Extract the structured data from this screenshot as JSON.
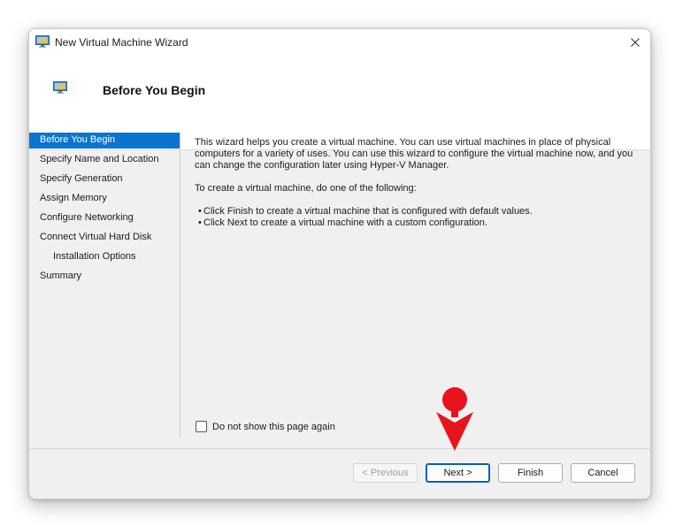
{
  "window": {
    "title": "New Virtual Machine Wizard",
    "header_title": "Before You Begin"
  },
  "nav": {
    "items": [
      {
        "label": "Before You Begin",
        "active": true
      },
      {
        "label": "Specify Name and Location"
      },
      {
        "label": "Specify Generation"
      },
      {
        "label": "Assign Memory"
      },
      {
        "label": "Configure Networking"
      },
      {
        "label": "Connect Virtual Hard Disk"
      },
      {
        "label": "Installation Options",
        "sub": true
      },
      {
        "label": "Summary"
      }
    ]
  },
  "content": {
    "intro": "This wizard helps you create a virtual machine. You can use virtual machines in place of physical computers for a variety of uses. You can use this wizard to configure the virtual machine now, and you can change the configuration later using Hyper-V Manager.",
    "instruction": "To create a virtual machine, do one of the following:",
    "bullets": [
      "Click Finish to create a virtual machine that is configured with default values.",
      "Click Next to create a virtual machine with a custom configuration."
    ],
    "bullet_glyph": "•",
    "checkbox_label": "Do not show this page again",
    "checkbox_checked": false
  },
  "buttons": {
    "previous": "< Previous",
    "next": "Next >",
    "finish": "Finish",
    "cancel": "Cancel"
  },
  "icons": {
    "title": "monitor-icon",
    "close": "close-icon",
    "header": "monitor-icon",
    "annotation": "red-arrow-pointer"
  },
  "colors": {
    "accent": "#0a74cf",
    "annotation": "#e8141c"
  }
}
